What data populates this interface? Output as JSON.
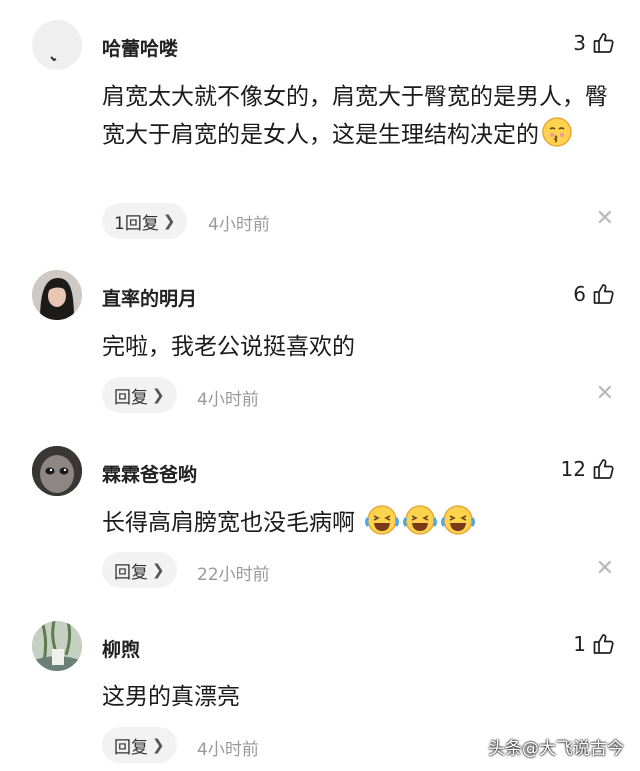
{
  "comments": [
    {
      "username": "哈蕾哈喽",
      "likes": "3",
      "text": "肩宽太大就不像女的，肩宽大于臀宽的是男人，臀宽大于肩宽的是女人，这是生理结构决定的",
      "emoji": "kissing-face",
      "reply_label": "1回复",
      "time": "4小时前"
    },
    {
      "username": "直率的明月",
      "likes": "6",
      "text": "完啦，我老公说挺喜欢的",
      "reply_label": "回复",
      "time": "4小时前"
    },
    {
      "username": "霖霖爸爸哟",
      "likes": "12",
      "text": "长得高肩膀宽也没毛病啊",
      "emoji": "laughing-crying-face x3",
      "reply_label": "回复",
      "time": "22小时前"
    },
    {
      "username": "柳煦",
      "likes": "1",
      "text": "这男的真漂亮",
      "reply_label": "回复",
      "time": "4小时前"
    }
  ],
  "icons": {
    "like": "thumbs-up-icon",
    "close": "close-icon",
    "chevron": "chevron-right-icon"
  },
  "watermark": "头条@大飞说古今"
}
